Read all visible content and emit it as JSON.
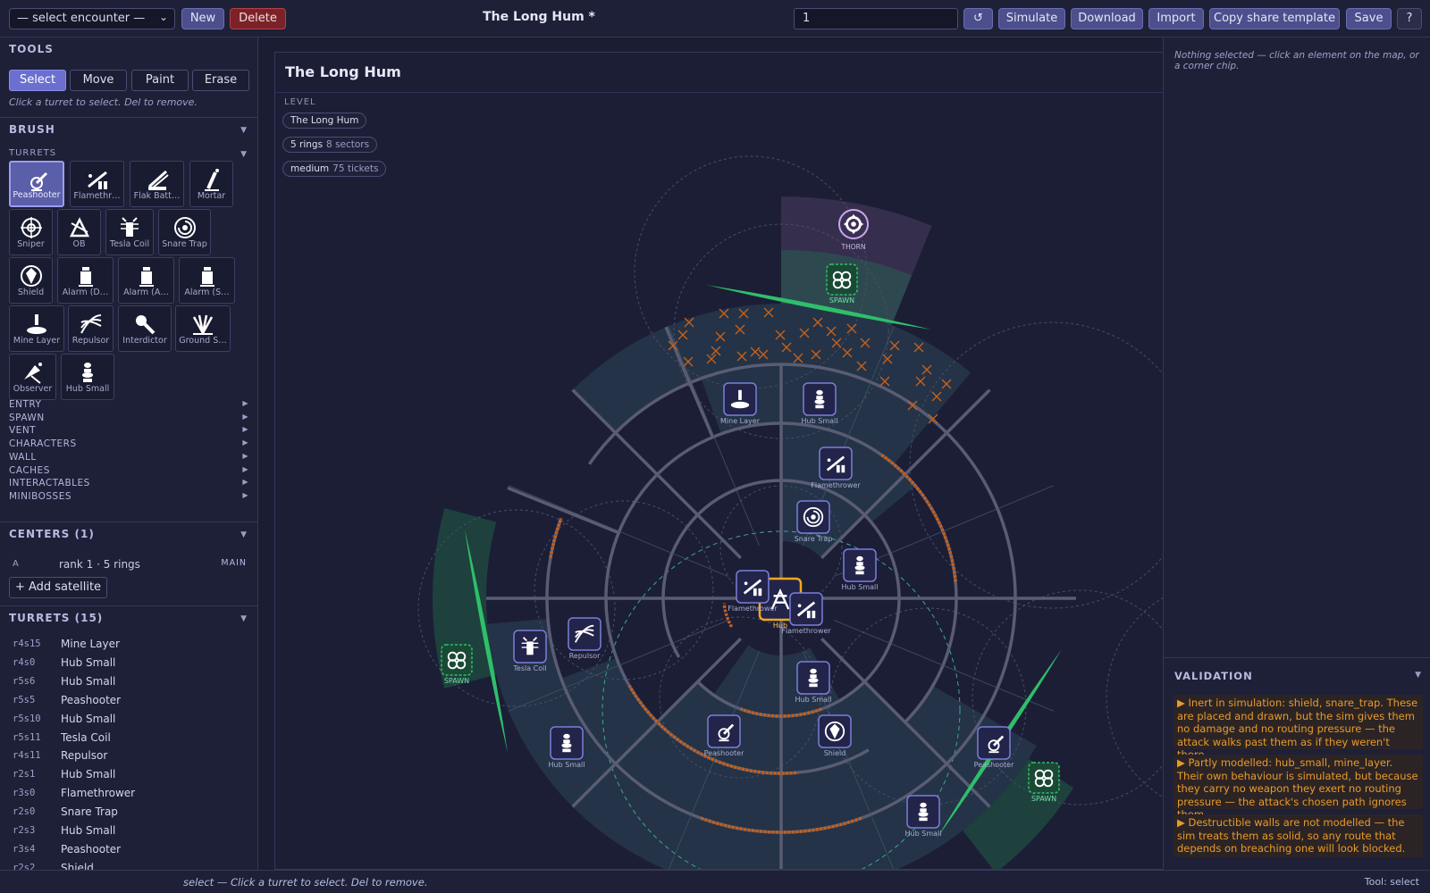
{
  "topbar": {
    "encounter_select": "— select encounter —",
    "new_label": "New",
    "delete_label": "Delete",
    "title": "The Long Hum *",
    "seed_value": "1",
    "reset_label": "↺",
    "simulate_label": "Simulate",
    "download_label": "Download",
    "import_label": "Import",
    "copy_label": "Copy share template",
    "save_label": "Save",
    "help_label": "?"
  },
  "tools": {
    "title": "TOOLS",
    "buttons": [
      "Select",
      "Move",
      "Paint",
      "Erase"
    ],
    "active": "Select",
    "hint": "Click a turret to select. Del to remove."
  },
  "brush": {
    "title": "BRUSH",
    "turrets_label": "TURRETS",
    "tiles": [
      {
        "label": "Peashooter",
        "icon": "peashooter-icon"
      },
      {
        "label": "Flamethr…",
        "icon": "flamethrower-icon"
      },
      {
        "label": "Flak Batt…",
        "icon": "flak-battery-icon"
      },
      {
        "label": "Mortar",
        "icon": "mortar-icon"
      },
      {
        "label": "Sniper",
        "icon": "sniper-icon"
      },
      {
        "label": "OB",
        "icon": "ob-icon"
      },
      {
        "label": "Tesla Coil",
        "icon": "tesla-coil-icon"
      },
      {
        "label": "Snare Trap",
        "icon": "snare-trap-icon"
      },
      {
        "label": "Shield",
        "icon": "shield-icon"
      },
      {
        "label": "Alarm (D…",
        "icon": "alarm-icon"
      },
      {
        "label": "Alarm (A…",
        "icon": "alarm-icon"
      },
      {
        "label": "Alarm (S…",
        "icon": "alarm-icon"
      },
      {
        "label": "Mine Layer",
        "icon": "mine-layer-icon"
      },
      {
        "label": "Repulsor",
        "icon": "repulsor-icon"
      },
      {
        "label": "Interdictor",
        "icon": "interdictor-icon"
      },
      {
        "label": "Ground S…",
        "icon": "ground-strike-icon"
      },
      {
        "label": "Observer",
        "icon": "observer-icon"
      },
      {
        "label": "Hub Small",
        "icon": "hub-small-icon"
      }
    ],
    "categories": [
      "ENTRY",
      "SPAWN",
      "VENT",
      "CHARACTERS",
      "WALL",
      "CACHES",
      "INTERACTABLES",
      "MINIBOSSES"
    ]
  },
  "centers": {
    "title": "CENTERS (1)",
    "items": [
      {
        "letter": "A",
        "desc": "rank 1 · 5 rings",
        "badge": "MAIN"
      }
    ],
    "add_label": "+ Add satellite"
  },
  "turrets_list": {
    "title": "TURRETS (15)",
    "rows": [
      {
        "id": "r4s15",
        "name": "Mine Layer"
      },
      {
        "id": "r4s0",
        "name": "Hub Small"
      },
      {
        "id": "r5s6",
        "name": "Hub Small"
      },
      {
        "id": "r5s5",
        "name": "Peashooter"
      },
      {
        "id": "r5s10",
        "name": "Hub Small"
      },
      {
        "id": "r5s11",
        "name": "Tesla Coil"
      },
      {
        "id": "r4s11",
        "name": "Repulsor"
      },
      {
        "id": "r2s1",
        "name": "Hub Small"
      },
      {
        "id": "r3s0",
        "name": "Flamethrower"
      },
      {
        "id": "r2s0",
        "name": "Snare Trap"
      },
      {
        "id": "r2s3",
        "name": "Hub Small"
      },
      {
        "id": "r3s4",
        "name": "Peashooter"
      },
      {
        "id": "r2s2",
        "name": "Shield"
      }
    ]
  },
  "map": {
    "title": "The Long Hum",
    "level_label": "LEVEL",
    "pills": [
      {
        "main": "The Long Hum",
        "dim": ""
      },
      {
        "main": "5 rings",
        "dim": "8 sectors"
      },
      {
        "main": "medium",
        "dim": "75 tickets"
      }
    ],
    "boss_label": "THORN",
    "spawn_label": "SPAWN",
    "hub_label": "Hub",
    "markers": [
      {
        "label": "Mine Layer",
        "icon": "mine-layer-icon"
      },
      {
        "label": "Hub Small",
        "icon": "hub-small-icon"
      },
      {
        "label": "Flamethrower",
        "icon": "flamethrower-icon"
      },
      {
        "label": "Snare Trap",
        "icon": "snare-trap-icon"
      },
      {
        "label": "Hub Small",
        "icon": "hub-small-icon"
      },
      {
        "label": "Flamethrower",
        "icon": "flamethrower-icon"
      },
      {
        "label": "Flamethrower",
        "icon": "flamethrower-icon"
      },
      {
        "label": "Repulsor",
        "icon": "repulsor-icon"
      },
      {
        "label": "Tesla Coil",
        "icon": "tesla-coil-icon"
      },
      {
        "label": "Hub Small",
        "icon": "hub-small-icon"
      },
      {
        "label": "Peashooter",
        "icon": "peashooter-icon"
      },
      {
        "label": "Shield",
        "icon": "shield-icon"
      },
      {
        "label": "Hub Small",
        "icon": "hub-small-icon"
      },
      {
        "label": "Hub Small",
        "icon": "hub-small-icon"
      },
      {
        "label": "Peashooter",
        "icon": "peashooter-icon"
      }
    ],
    "colors": {
      "ring": "#5a5c74",
      "highlight": "#3a5d68",
      "path": "#c4601a",
      "spawn": "#2fbf6a",
      "selected": "#f2a81d",
      "marker_border": "#7b7fd8"
    }
  },
  "inspector": {
    "hint": "Nothing selected — click an element on the map, or a corner chip."
  },
  "validation": {
    "title": "VALIDATION",
    "warnings": [
      "▶ Inert in simulation: shield, snare_trap. These are placed and drawn, but the sim gives them no damage and no routing pressure — the attack walks past them as if they weren't there.",
      "▶ Partly modelled: hub_small, mine_layer. Their own behaviour is simulated, but because they carry no weapon they exert no routing pressure — the attack's chosen path ignores them.",
      "▶ Destructible walls are not modelled — the sim treats them as solid, so any route that depends on breaching one will look blocked."
    ]
  },
  "status": {
    "text": "select — Click a turret to select. Del to remove.",
    "tool": "Tool: select"
  }
}
